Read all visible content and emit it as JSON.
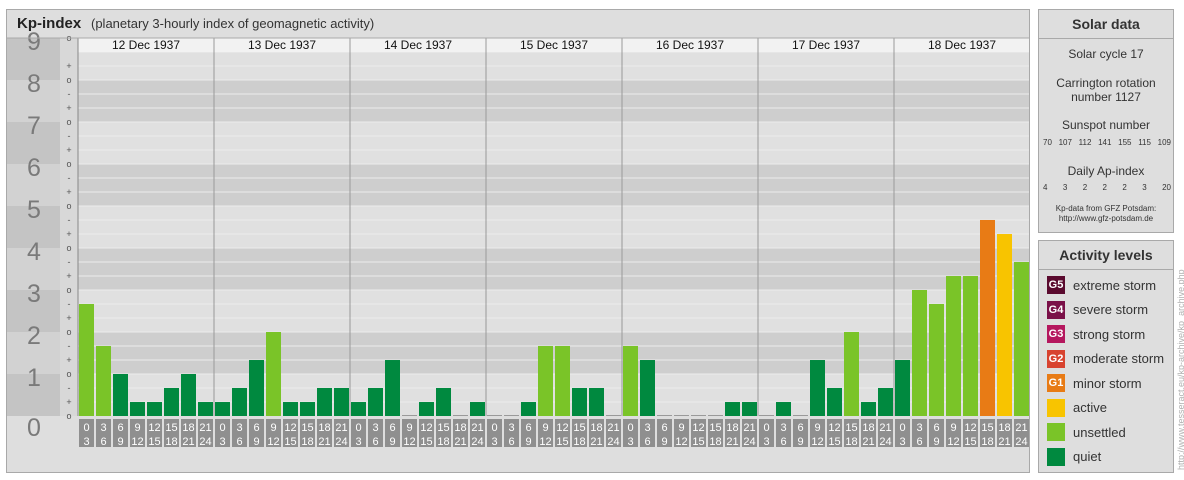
{
  "title": {
    "main": "Kp-index",
    "subtitle": "(planetary 3-hourly index of geomagnetic activity)"
  },
  "colors": {
    "quiet": "#00893f",
    "unsettled": "#7ac428",
    "active": "#f8c400",
    "minor_storm": "#e87b15"
  },
  "chart_data": {
    "type": "bar",
    "title": "Kp-index",
    "ylim": [
      0,
      9
    ],
    "yticks": [
      "0",
      "1",
      "2",
      "3",
      "4",
      "5",
      "6",
      "7",
      "8",
      "9"
    ],
    "minor_marks": [
      "-",
      "o",
      "+"
    ],
    "days": [
      "12 Dec 1937",
      "13 Dec 1937",
      "14 Dec 1937",
      "15 Dec 1937",
      "16 Dec 1937",
      "17 Dec 1937",
      "18 Dec 1937"
    ],
    "hour_bins": [
      [
        "0",
        "3"
      ],
      [
        "3",
        "6"
      ],
      [
        "6",
        "9"
      ],
      [
        "9",
        "12"
      ],
      [
        "12",
        "15"
      ],
      [
        "15",
        "18"
      ],
      [
        "18",
        "21"
      ],
      [
        "21",
        "24"
      ]
    ],
    "values": [
      [
        2.667,
        1.667,
        1.0,
        0.333,
        0.333,
        0.667,
        1.0,
        0.333
      ],
      [
        0.333,
        0.667,
        1.333,
        2.0,
        0.333,
        0.333,
        0.667,
        0.667
      ],
      [
        0.333,
        0.667,
        1.333,
        0.0,
        0.333,
        0.667,
        0.0,
        0.333
      ],
      [
        0.0,
        0.0,
        0.333,
        1.667,
        1.667,
        0.667,
        0.667,
        0.0
      ],
      [
        1.667,
        1.333,
        0.0,
        0.0,
        0.0,
        0.0,
        0.333,
        0.333
      ],
      [
        0.0,
        0.333,
        0.0,
        1.333,
        0.667,
        2.0,
        0.333,
        0.667
      ],
      [
        1.333,
        3.0,
        2.667,
        3.333,
        3.333,
        4.667,
        4.333,
        3.667
      ]
    ]
  },
  "solar": {
    "heading": "Solar data",
    "cycle": "Solar cycle 17",
    "carrington_line1": "Carrington rotation",
    "carrington_line2": "number 1127",
    "sunspot_heading": "Sunspot number",
    "sunspot": [
      "70",
      "107",
      "112",
      "141",
      "155",
      "115",
      "109"
    ],
    "ap_heading": "Daily Ap-index",
    "ap": [
      "4",
      "3",
      "2",
      "2",
      "2",
      "3",
      "20"
    ],
    "credit_line1": "Kp-data from GFZ Potsdam:",
    "credit_line2": "http://www.gfz-potsdam.de"
  },
  "activity": {
    "heading": "Activity levels",
    "levels": [
      {
        "badge": "G5",
        "label": "extreme storm",
        "color": "#5a0a2e"
      },
      {
        "badge": "G4",
        "label": "severe storm",
        "color": "#7a1048"
      },
      {
        "badge": "G3",
        "label": "strong storm",
        "color": "#b5175e"
      },
      {
        "badge": "G2",
        "label": "moderate storm",
        "color": "#d8432f"
      },
      {
        "badge": "G1",
        "label": "minor storm",
        "color": "#e87b15"
      },
      {
        "badge": "",
        "label": "active",
        "color": "#f8c400"
      },
      {
        "badge": "",
        "label": "unsettled",
        "color": "#7ac428"
      },
      {
        "badge": "",
        "label": "quiet",
        "color": "#00893f"
      }
    ]
  },
  "watermark": "http://www.tesseract.eu/kp-archive/kp_archive.php"
}
